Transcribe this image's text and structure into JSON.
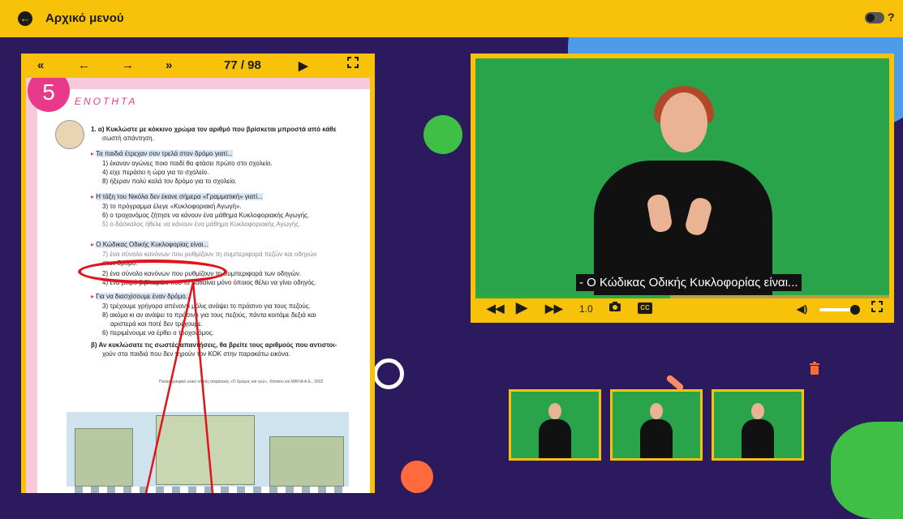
{
  "header": {
    "back_icon": "arrow-left-circle-icon",
    "title": "Αρχικό μενού",
    "help_label": "?"
  },
  "viewer": {
    "first_label": "«",
    "prev_label": "←",
    "next_label": "→",
    "last_label": "»",
    "page_indicator": "77 / 98",
    "play_label": "▶",
    "fullscreen_icon": "fullscreen-icon"
  },
  "document": {
    "unit_number": "5",
    "unit_word": "ΕΝΟΤΗΤΑ",
    "question": "1. α) Κυκλώστε με κόκκινο χρώμα τον αριθμό που βρίσκεται μπροστά από κάθε",
    "question_cont": "σωστή απάντηση.",
    "groups": [
      {
        "prompt": "Τα παιδιά έτρεχαν σαν τρελά στον δρόμο γιατί...",
        "options": [
          "1) έκαναν αγώνες ποιο παιδί θα φτάσει πρώτο στο σχολείο.",
          "4) είχε περάσει η ώρα για το σχολείο.",
          "8) ήξεραν πολύ καλά τον δρόμο για το σχολείο."
        ]
      },
      {
        "prompt": "Η τάξη του Νικόλα δεν έκανε σήμερα «Γραμματική» γιατί...",
        "options": [
          "3) το πρόγραμμα έλεγε «Κυκλοφοριακή Αγωγή».",
          "6) ο τροχονόμος ζήτησε να κάνουν ένα μάθημα Κυκλοφοριακής Αγωγής.",
          "5) ο δάσκαλος ήθελε να κάνουν ένα μάθημα Κυκλοφοριακής Αγωγής."
        ]
      },
      {
        "prompt": "Ο Κώδικας Οδικής Κυκλοφορίας είναι...",
        "options": [
          "7) ένα σύνολο κανόνων που ρυθμίζουν τη συμπεριφορά πεζών και οδηγών",
          "στον δρόμο.",
          "2) ένα σύνολο κανόνων που ρυθμίζουν τη συμπεριφορά των οδηγών.",
          "4) ένα μικρό βιβλιαράκι που το μαθαίνει μόνο όποιος θέλει να γίνει οδηγός."
        ]
      },
      {
        "prompt": "Για να διασχίσουμε έναν δρόμο...",
        "options": [
          "3) τρέχουμε γρήγορα απέναντι μόλις ανάψει το πράσινο για τους πεζούς.",
          "8) ακόμα κι αν ανάψει το πράσινο για τους πεζούς, πάντα κοιτάμε δεξιά και",
          "αριστερά και ποτέ δεν τρέχουμε.",
          "6) περιμένουμε να έρθει ο τροχονόμος."
        ]
      }
    ],
    "beta_1": "β) Αν κυκλώσατε τις σωστές απαντήσεις, θα βρείτε τους αριθμούς που αντιστοι-",
    "beta_2": "χούν στα παιδιά που δεν τηρούν τον ΚΟΚ στην παρακάτω εικόνα.",
    "credit": "Πινακογραφικό υλικό οδικής ασφάλειας «Ο δρόμος και εγώ», Χάτσιού και ΜΑΥΙΑ Α.Ε., 2002"
  },
  "video": {
    "caption": "- Ο Κώδικας Οδικής Κυκλοφορίας είναι...",
    "progress": 0.47,
    "speed": "1.0",
    "cc_label": "CC",
    "volume": 0.9,
    "icons": [
      "rewind-icon",
      "play-icon",
      "fast-forward-icon",
      "camera-icon",
      "cc-icon",
      "volume-icon",
      "fullscreen-icon"
    ]
  },
  "colors": {
    "accent": "#f8c20a",
    "background": "#2b1a5e",
    "video_green": "#29a44a",
    "highlight_red": "#e0151c",
    "pink": "#e8398a"
  }
}
